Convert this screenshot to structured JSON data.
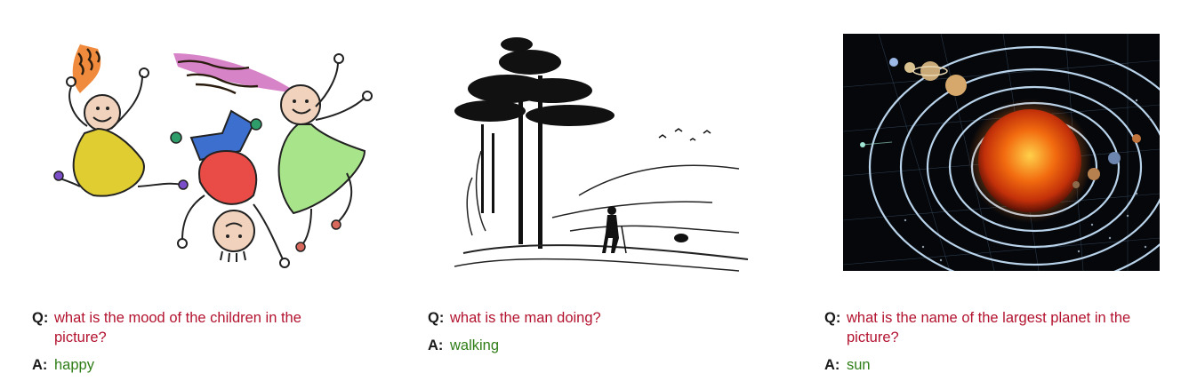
{
  "colors": {
    "question": "#b3132f",
    "answer": "#2e7d16",
    "label": "#1a1a1a"
  },
  "panels": [
    {
      "image_icon": "children-drawing",
      "q_label": "Q:",
      "question": "what is the mood of the children in the picture?",
      "a_label": "A:",
      "answer": "happy"
    },
    {
      "image_icon": "man-walking-landscape",
      "q_label": "Q:",
      "question": "what is the man doing?",
      "a_label": "A:",
      "answer": "walking"
    },
    {
      "image_icon": "solar-system",
      "q_label": "Q:",
      "question": "what is the name of the largest planet in the picture?",
      "a_label": "A:",
      "answer": "sun"
    }
  ]
}
